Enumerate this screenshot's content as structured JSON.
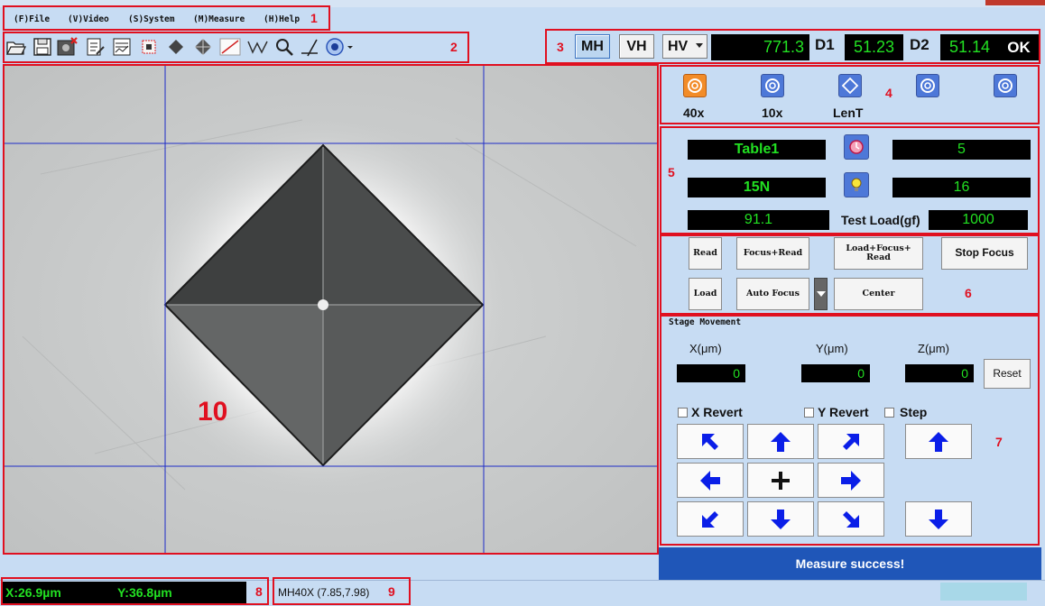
{
  "menu": [
    {
      "label": "(F)File"
    },
    {
      "label": "(V)Video"
    },
    {
      "label": "(S)System"
    },
    {
      "label": "(M)Measure"
    },
    {
      "label": "(H)Help"
    }
  ],
  "toolbar_icons": [
    "open-folder-icon",
    "save-icon",
    "delete-image-icon",
    "report-icon",
    "chart-icon",
    "select-region-icon",
    "diamond-fill-icon",
    "diamond-star-icon",
    "diagonal-line-icon",
    "polyline-icon",
    "zoom-icon",
    "angle-measure-icon",
    "settings-gear-icon"
  ],
  "hardness": {
    "mode_buttons": [
      "MH",
      "VH"
    ],
    "scale_select": "HV",
    "value": "771.3",
    "d1_label": "D1",
    "d1_value": "51.23",
    "d2_label": "D2",
    "d2_value": "51.14",
    "status": "OK"
  },
  "objectives": [
    {
      "label": "40x",
      "icon": "objective-lens-icon",
      "active": true
    },
    {
      "label": "10x",
      "icon": "objective-lens-icon",
      "active": false
    },
    {
      "label": "LenT",
      "icon": "diamond-indenter-icon",
      "active": false
    },
    {
      "label": "",
      "icon": "objective-lens-icon",
      "active": false
    },
    {
      "label": "",
      "icon": "objective-lens-icon",
      "active": false
    }
  ],
  "test": {
    "table": "Table1",
    "dwell": "5",
    "force": "15N",
    "light": "16",
    "hardness_display": "91.1",
    "load_label": "Test Load(gf)",
    "load_value": "1000"
  },
  "controls": {
    "read": "Read",
    "focus_read": "Focus+Read",
    "load_focus_read": "Load+Focus+\nRead",
    "stop_focus": "Stop Focus",
    "load": "Load",
    "auto_focus": "Auto Focus",
    "center": "Center"
  },
  "stage": {
    "title": "Stage Movement",
    "x_label": "X(μm)",
    "y_label": "Y(μm)",
    "z_label": "Z(μm)",
    "x_value": "0",
    "y_value": "0",
    "z_value": "0",
    "reset": "Reset",
    "x_revert": "X Revert",
    "y_revert": "Y Revert",
    "step": "Step"
  },
  "status_message": "Measure success!",
  "statusbar": {
    "x": "X:26.9µm",
    "y": "Y:36.8µm",
    "lens": "MH40X  (7.85,7.98)"
  },
  "annotations": {
    "n1": "1",
    "n2": "2",
    "n3": "3",
    "n4": "4",
    "n5": "5",
    "n6": "6",
    "n7": "7",
    "n8": "8",
    "n9": "9",
    "n10": "10"
  },
  "colors": {
    "annotation_red": "#e01020",
    "lcd_green": "#22e022",
    "panel_blue": "#c7dcf3",
    "arrow_blue": "#0a1ee8",
    "status_blue": "#1f56b8"
  }
}
